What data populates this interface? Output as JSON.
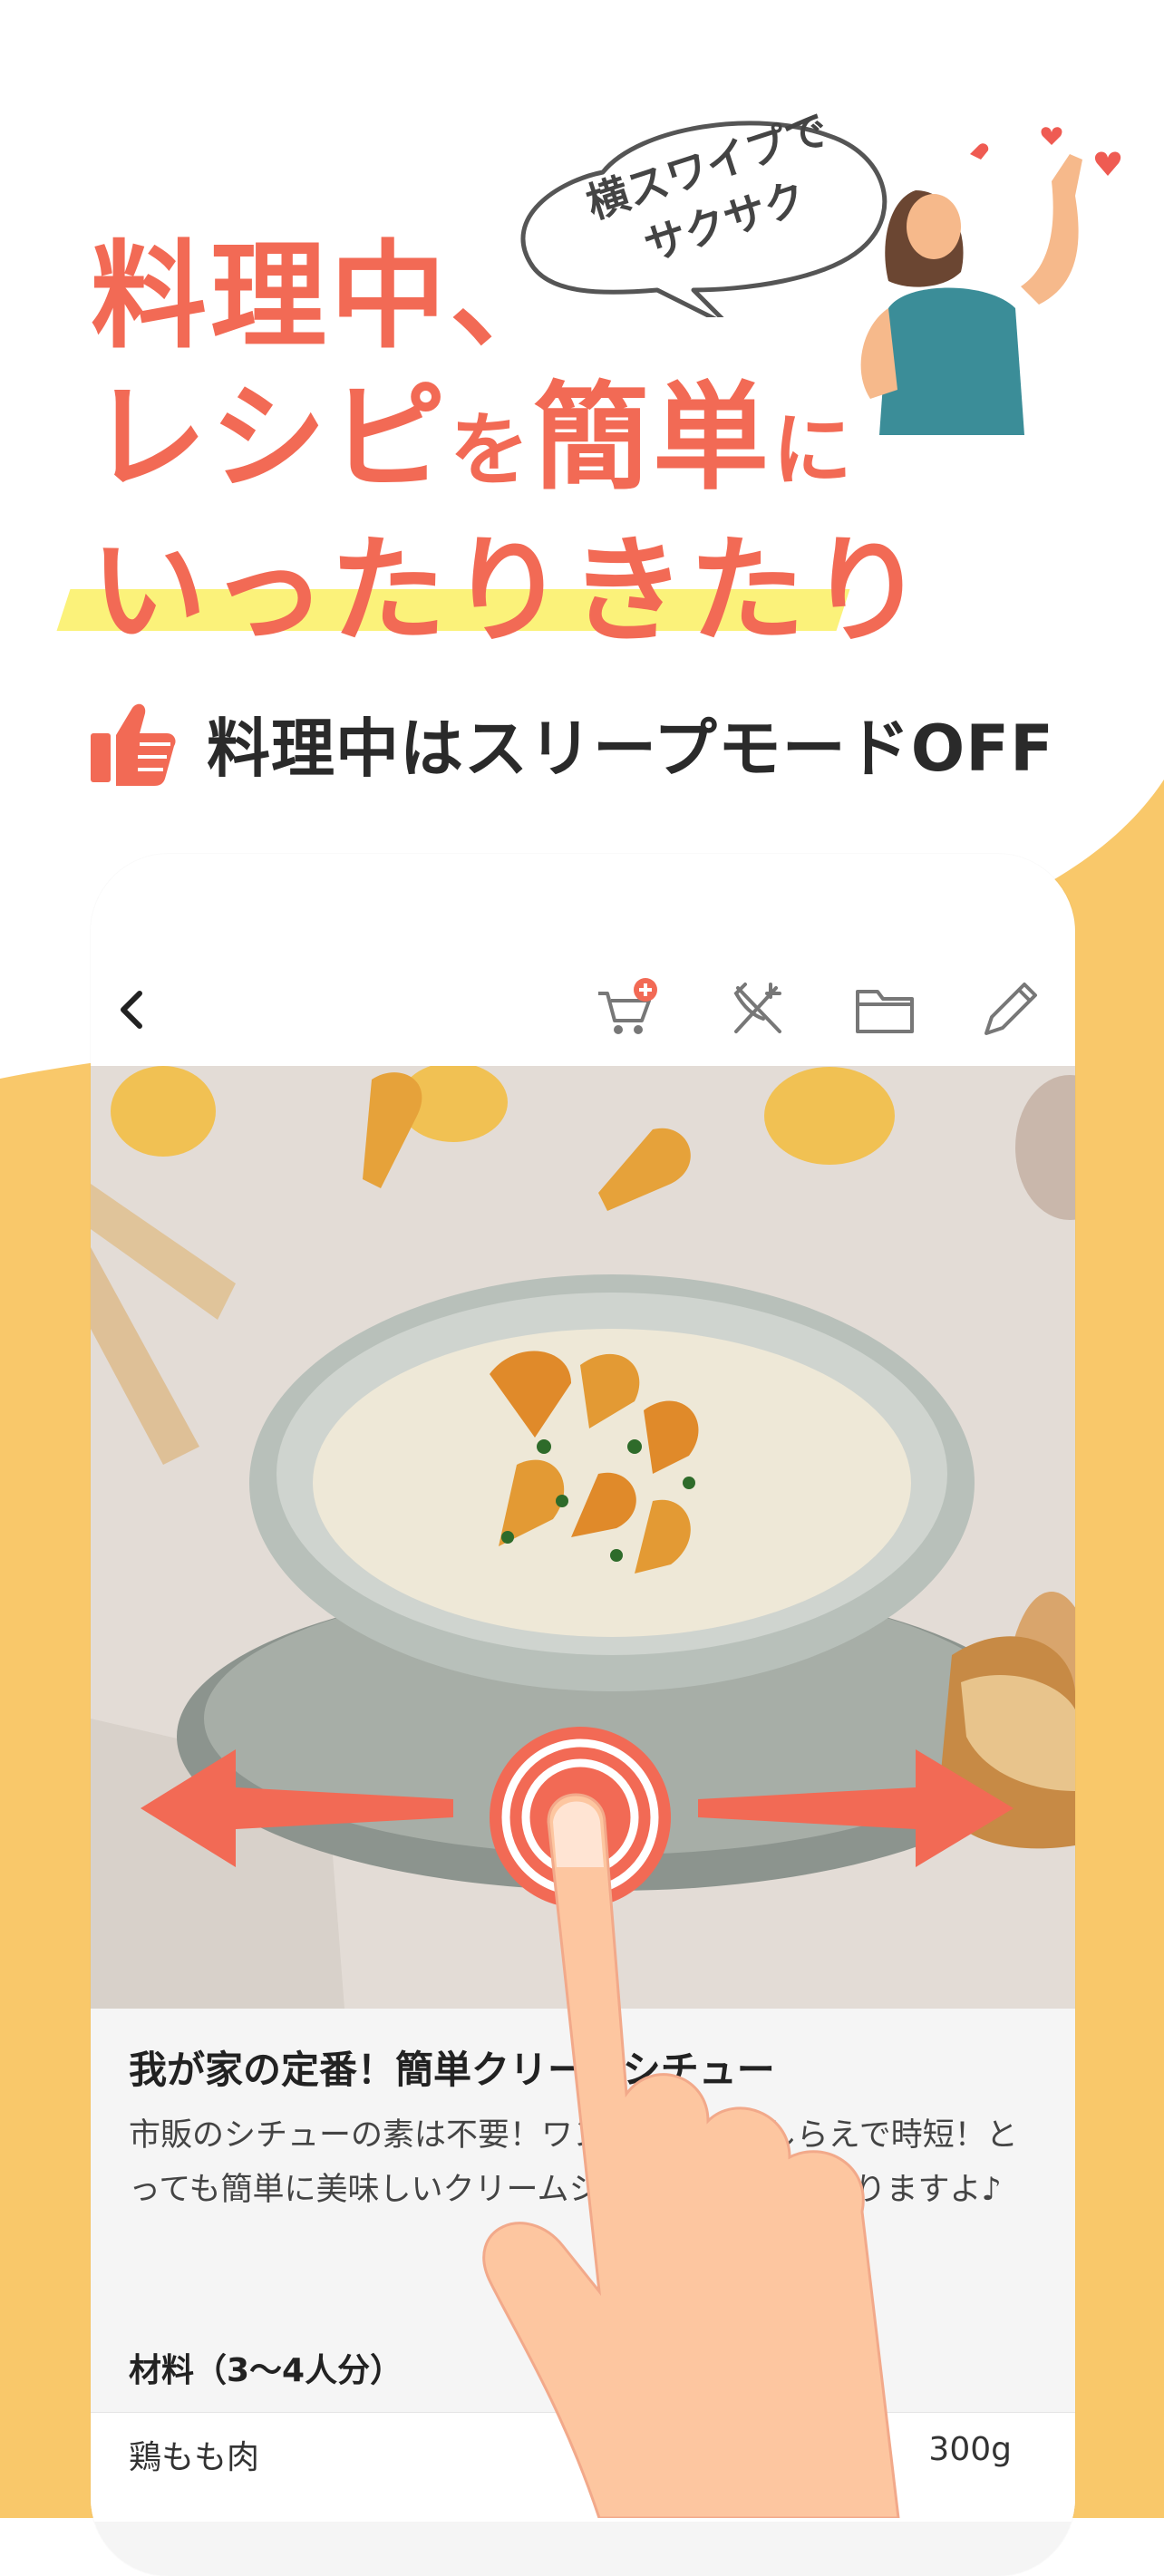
{
  "headline": {
    "line1": "料理中、",
    "line2a": "レシピ",
    "line2b": "を",
    "line2c": "簡単",
    "line2d": "に",
    "line3": "いったりきたり"
  },
  "bubble": {
    "line1": "横スワイプで",
    "line2": "サクサク"
  },
  "subheading": "料理中はスリープモードOFF",
  "nav": {
    "back_icon": "chevron-left-icon",
    "icons": [
      "cart-add-icon",
      "utensils-icon",
      "folder-icon",
      "pencil-icon"
    ]
  },
  "recipe": {
    "title": "我が家の定番！簡単クリームシチュー",
    "description": "市販のシチューの素は不要！ワンパンで下ごしらえで時短！とっても簡単に美味しいクリームシチューが出来上がりますよ♪",
    "ingredients_heading": "材料（3〜4人分）",
    "first_ingredient": "鶏もも肉",
    "first_quantity": "300g"
  },
  "colors": {
    "accent": "#f26a55",
    "yellow": "#f9c86a",
    "highlight": "#fbf27a"
  }
}
